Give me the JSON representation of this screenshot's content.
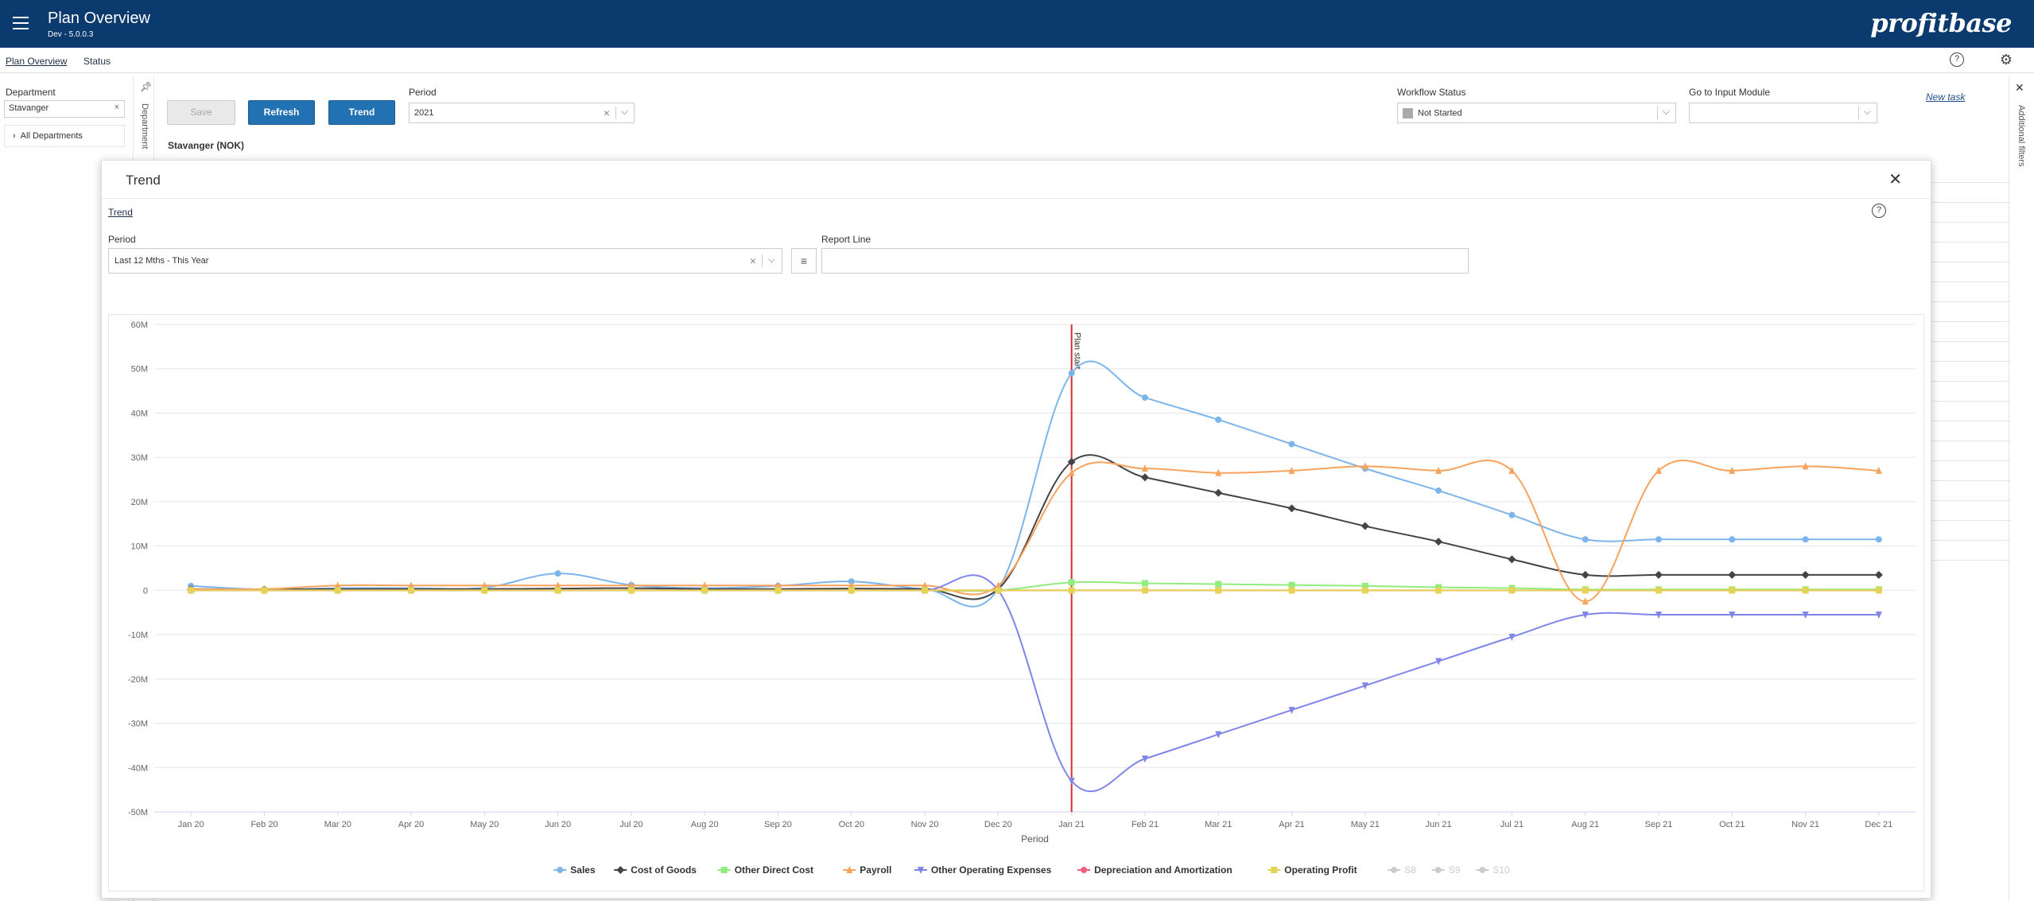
{
  "header": {
    "title": "Plan Overview",
    "version": "Dev - 5.0.0.3",
    "logo": "profitbase"
  },
  "subnav": {
    "tabs": [
      {
        "label": "Plan Overview",
        "active": true
      },
      {
        "label": "Status",
        "active": false
      }
    ],
    "help_icon": "?",
    "settings_icon": "⚙"
  },
  "department": {
    "label": "Department",
    "value": "Stavanger",
    "tree_item": "All Departments",
    "vertical_label": "Department"
  },
  "toolbar": {
    "save_label": "Save",
    "refresh_label": "Refresh",
    "trend_label": "Trend",
    "period_label": "Period",
    "period_value": "2021",
    "workflow_label": "Workflow Status",
    "workflow_value": "Not Started",
    "input_module_label": "Go to Input Module",
    "input_module_value": "",
    "new_task_label": "New task",
    "entity_label": "Stavanger (NOK)"
  },
  "right_panel": {
    "label": "Additional filters"
  },
  "modal": {
    "title": "Trend",
    "tab": "Trend",
    "period_label": "Period",
    "period_value": "Last 12 Mths - This Year",
    "report_line_label": "Report Line",
    "report_line_value": ""
  },
  "chart_data": {
    "type": "line",
    "xlabel": "Period",
    "ylabel": "",
    "ylim": [
      -50000000,
      60000000
    ],
    "yticks": [
      {
        "v": 60000000,
        "label": "60M"
      },
      {
        "v": 50000000,
        "label": "50M"
      },
      {
        "v": 40000000,
        "label": "40M"
      },
      {
        "v": 30000000,
        "label": "30M"
      },
      {
        "v": 20000000,
        "label": "20M"
      },
      {
        "v": 10000000,
        "label": "10M"
      },
      {
        "v": 0,
        "label": "0"
      },
      {
        "v": -10000000,
        "label": "-10M"
      },
      {
        "v": -20000000,
        "label": "-20M"
      },
      {
        "v": -30000000,
        "label": "-30M"
      },
      {
        "v": -40000000,
        "label": "-40M"
      },
      {
        "v": -50000000,
        "label": "-50M"
      }
    ],
    "categories": [
      "Jan 20",
      "Feb 20",
      "Mar 20",
      "Apr 20",
      "May 20",
      "Jun 20",
      "Jul 20",
      "Aug 20",
      "Sep 20",
      "Oct 20",
      "Nov 20",
      "Dec 20",
      "Jan 21",
      "Feb 21",
      "Mar 21",
      "Apr 21",
      "May 21",
      "Jun 21",
      "Jul 21",
      "Aug 21",
      "Sep 21",
      "Oct 21",
      "Nov 21",
      "Dec 21"
    ],
    "plan_line": {
      "category": "Jan 21",
      "label": "Plan start"
    },
    "grid": true,
    "legend_position": "bottom",
    "series": [
      {
        "name": "Sales",
        "color": "#7cb5ec",
        "marker": "circle",
        "values": [
          1000000,
          200000,
          500000,
          500000,
          600000,
          3800000,
          1200000,
          500000,
          1000000,
          2000000,
          300000,
          300000,
          49000000,
          43500000,
          38500000,
          33000000,
          27500000,
          22500000,
          17000000,
          11500000,
          11500000,
          11500000,
          11500000,
          11500000
        ]
      },
      {
        "name": "Cost of Goods",
        "color": "#434348",
        "marker": "diamond",
        "values": [
          300000,
          200000,
          300000,
          300000,
          300000,
          400000,
          500000,
          300000,
          300000,
          400000,
          300000,
          300000,
          29000000,
          25500000,
          22000000,
          18500000,
          14500000,
          11000000,
          7000000,
          3500000,
          3500000,
          3500000,
          3500000,
          3500000
        ]
      },
      {
        "name": "Other Direct Cost",
        "color": "#90ed7d",
        "marker": "square",
        "values": [
          0,
          0,
          0,
          0,
          0,
          0,
          0,
          0,
          0,
          0,
          0,
          0,
          1800000,
          1600000,
          1400000,
          1200000,
          1000000,
          700000,
          500000,
          200000,
          200000,
          200000,
          200000,
          200000
        ]
      },
      {
        "name": "Payroll",
        "color": "#f7a35c",
        "marker": "triangle",
        "values": [
          300000,
          300000,
          1100000,
          1100000,
          1100000,
          1100000,
          1100000,
          1100000,
          1100000,
          1100000,
          1100000,
          1100000,
          26500000,
          27500000,
          26500000,
          27000000,
          28000000,
          27000000,
          27000000,
          -2500000,
          27000000,
          27000000,
          28000000,
          27000000
        ]
      },
      {
        "name": "Other Operating Expenses",
        "color": "#8085e9",
        "marker": "triangle-down",
        "values": [
          0,
          0,
          0,
          0,
          0,
          0,
          0,
          0,
          0,
          0,
          0,
          0,
          -43000000,
          -38000000,
          -32500000,
          -27000000,
          -21500000,
          -16000000,
          -10500000,
          -5500000,
          -5500000,
          -5500000,
          -5500000,
          -5500000
        ]
      },
      {
        "name": "Depreciation and Amortization",
        "color": "#f15c80",
        "marker": "circle",
        "values": [
          0,
          0,
          0,
          0,
          0,
          0,
          0,
          0,
          0,
          0,
          0,
          0,
          0,
          0,
          0,
          0,
          0,
          0,
          0,
          0,
          0,
          0,
          0,
          0
        ]
      },
      {
        "name": "Operating Profit",
        "color": "#e4d354",
        "marker": "square",
        "values": [
          0,
          0,
          0,
          0,
          0,
          0,
          0,
          0,
          0,
          0,
          0,
          0,
          0,
          0,
          0,
          0,
          0,
          0,
          0,
          0,
          0,
          0,
          0,
          0
        ]
      }
    ],
    "inactive_legend": [
      "S8",
      "S9",
      "S10"
    ]
  }
}
